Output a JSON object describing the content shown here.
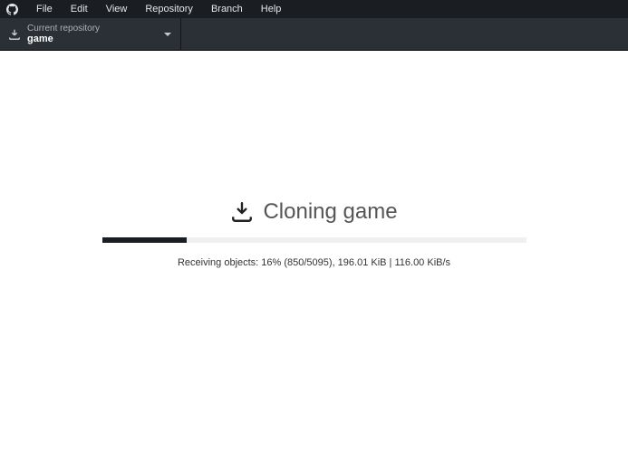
{
  "menubar": {
    "items": [
      "File",
      "Edit",
      "View",
      "Repository",
      "Branch",
      "Help"
    ]
  },
  "toolbar": {
    "repo_label": "Current repository",
    "repo_name": "game"
  },
  "main": {
    "title": "Cloning game",
    "progress_percent": 20,
    "status": "Receiving objects: 16% (850/5095), 196.01 KiB | 116.00 KiB/s"
  }
}
